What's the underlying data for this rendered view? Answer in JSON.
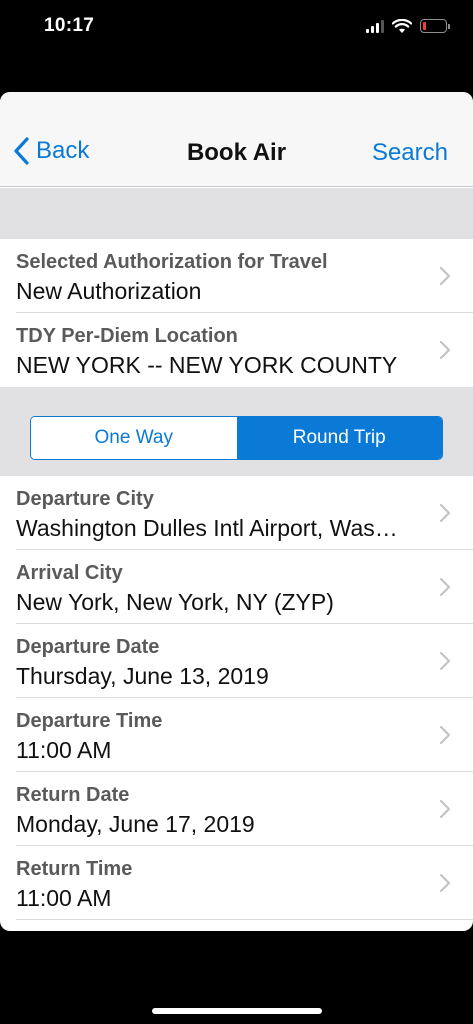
{
  "status_bar": {
    "time": "10:17"
  },
  "nav": {
    "back_label": "Back",
    "title": "Book Air",
    "search_label": "Search"
  },
  "authorization": {
    "label": "Selected Authorization for Travel",
    "value": "New Authorization"
  },
  "per_diem": {
    "label": "TDY Per-Diem Location",
    "value": "NEW YORK -- NEW YORK COUNTY"
  },
  "trip_type": {
    "options": [
      "One Way",
      "Round Trip"
    ],
    "selected": "Round Trip"
  },
  "fields": [
    {
      "label": "Departure City",
      "value": "Washington Dulles Intl Airport, Was…"
    },
    {
      "label": "Arrival City",
      "value": "New York, New York, NY (ZYP)"
    },
    {
      "label": "Departure Date",
      "value": "Thursday, June 13, 2019"
    },
    {
      "label": "Departure Time",
      "value": "11:00 AM"
    },
    {
      "label": "Return Date",
      "value": "Monday, June 17, 2019"
    },
    {
      "label": "Return Time",
      "value": "11:00 AM"
    }
  ],
  "colors": {
    "accent": "#0a7ad6",
    "section_background": "#e1e1e4",
    "nav_background": "#f7f7f7",
    "battery_low": "#ff3b30"
  },
  "icons": [
    "back-chevron-icon",
    "chevron-right-icon",
    "signal-icon",
    "wifi-icon",
    "battery-icon"
  ]
}
